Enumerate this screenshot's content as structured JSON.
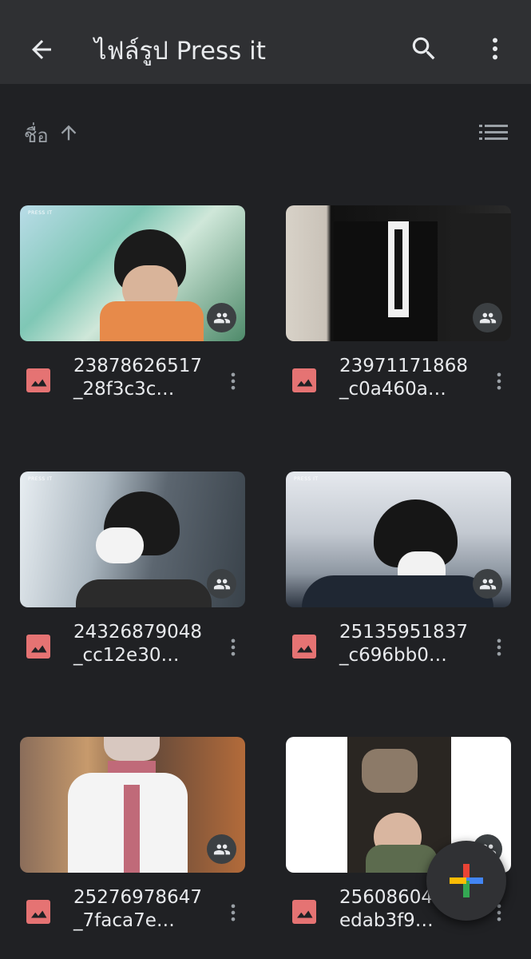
{
  "appbar": {
    "title": "ไฟล์รูป Press it"
  },
  "sort": {
    "label": "ชื่อ"
  },
  "files": [
    {
      "name": "23878626517_28f3c3c…",
      "caption": "PRESS IT"
    },
    {
      "name": "23971171868_c0a460a…",
      "caption": ""
    },
    {
      "name": "24326879048_cc12e30…",
      "caption": "PRESS IT"
    },
    {
      "name": "25135951837_c696bb0…",
      "caption": "PRESS IT"
    },
    {
      "name": "25276978647_7faca7e…",
      "caption": ""
    },
    {
      "name": "25608604…7_edab3f9…",
      "caption": ""
    }
  ],
  "colors": {
    "background": "#202124",
    "appbar": "#2f3033",
    "image_type": "#e57373"
  }
}
